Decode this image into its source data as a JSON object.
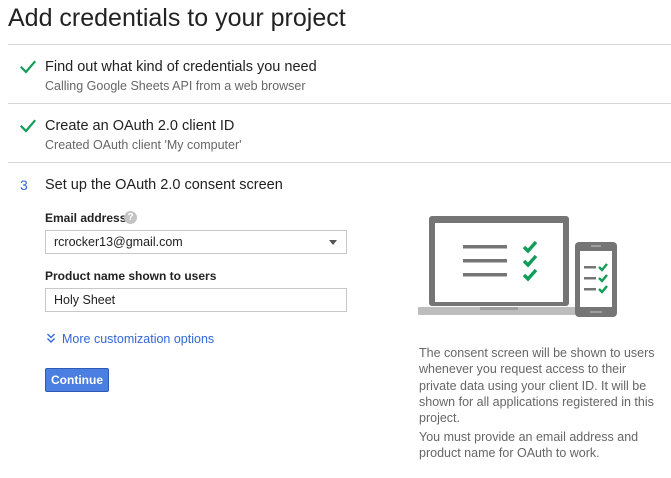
{
  "page": {
    "title": "Add credentials to your project"
  },
  "steps": [
    {
      "marker": "check",
      "title": "Find out what kind of credentials you need",
      "subtitle": "Calling Google Sheets API from a web browser"
    },
    {
      "marker": "check",
      "title": "Create an OAuth 2.0 client ID",
      "subtitle": "Created OAuth client 'My computer'"
    },
    {
      "marker": "3",
      "title": "Set up the OAuth 2.0 consent screen"
    }
  ],
  "form": {
    "email_label": "Email address",
    "email_help_icon": "question-mark",
    "email_value": "rcrocker13@gmail.com",
    "product_label": "Product name shown to users",
    "product_value": "Holy Sheet",
    "more_options_label": "More customization options",
    "continue_label": "Continue"
  },
  "info": {
    "paragraph1": "The consent screen will be shown to users whenever you request access to their private data using your client ID. It will be shown for all applications registered in this project.",
    "paragraph2": "You must provide an email address and product name for OAuth to work."
  },
  "colors": {
    "check": "#0f9d58",
    "accent": "#3367d6",
    "button": "#4a7ee0",
    "illustration_device": "#757575"
  }
}
